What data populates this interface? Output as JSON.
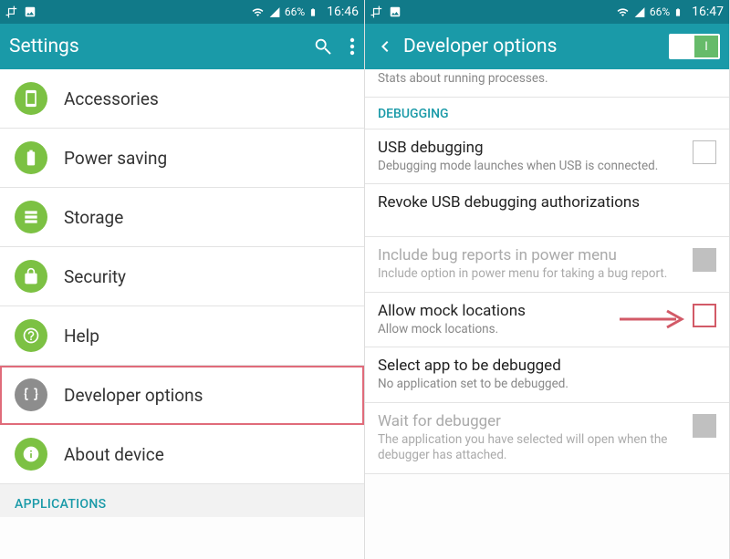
{
  "left": {
    "status": {
      "battery": "66%",
      "time": "16:46"
    },
    "title": "Settings",
    "items": [
      {
        "label": "Accessories",
        "color": "green",
        "icon": "accessories-icon"
      },
      {
        "label": "Power saving",
        "color": "green",
        "icon": "battery-icon"
      },
      {
        "label": "Storage",
        "color": "green",
        "icon": "storage-icon"
      },
      {
        "label": "Security",
        "color": "green",
        "icon": "lock-icon"
      },
      {
        "label": "Help",
        "color": "green",
        "icon": "help-icon"
      },
      {
        "label": "Developer options",
        "color": "grey",
        "icon": "braces-icon",
        "highlighted": true
      },
      {
        "label": "About device",
        "color": "green",
        "icon": "info-icon"
      }
    ],
    "section_after": "APPLICATIONS"
  },
  "right": {
    "status": {
      "battery": "66%",
      "time": "16:47"
    },
    "title": "Developer options",
    "toggle_on_label": "I",
    "partial_top_sub": "Stats about running processes.",
    "section": "DEBUGGING",
    "items": [
      {
        "title": "USB debugging",
        "sub": "Debugging mode launches when USB is connected.",
        "checkbox": "empty"
      },
      {
        "title": "Revoke USB debugging authorizations"
      },
      {
        "title": "Include bug reports in power menu",
        "sub": "Include option in power menu for taking a bug report.",
        "checkbox": "greyfill",
        "disabled": true
      },
      {
        "title": "Allow mock locations",
        "sub": "Allow mock locations.",
        "checkbox": "red",
        "highlighted": true
      },
      {
        "title": "Select app to be debugged",
        "sub": "No application set to be debugged."
      },
      {
        "title": "Wait for debugger",
        "sub": "The application you have selected will open when the debugger has attached.",
        "checkbox": "greyfill",
        "disabled": true
      }
    ]
  }
}
